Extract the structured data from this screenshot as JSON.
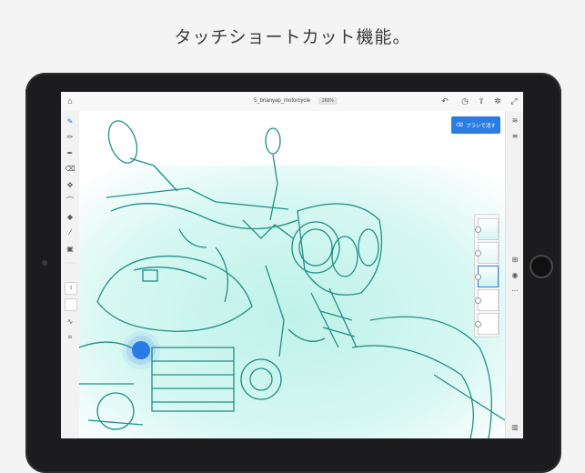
{
  "headline": "タッチショートカット機能。",
  "topbar": {
    "doc_title": "5_brianyap_motorcycle",
    "zoom": "265%",
    "home_icon": "home-icon",
    "undo_icon": "undo-icon",
    "history_icon": "history-icon",
    "share_icon": "share-icon",
    "settings_icon": "gear-icon",
    "fullscreen_icon": "expand-icon"
  },
  "left_tools": [
    {
      "name": "brush-tool",
      "glyph": "✎",
      "active": true
    },
    {
      "name": "pencil-tool",
      "glyph": "✏"
    },
    {
      "name": "ink-pen-tool",
      "glyph": "✒"
    },
    {
      "name": "eraser-tool",
      "glyph": "⌫"
    },
    {
      "name": "move-tool",
      "glyph": "✥"
    },
    {
      "name": "lasso-tool",
      "glyph": "⌒"
    },
    {
      "name": "fill-tool",
      "glyph": "◆"
    },
    {
      "name": "eyedropper-tool",
      "glyph": "⁄"
    },
    {
      "name": "image-tool",
      "glyph": "▣"
    }
  ],
  "brush_size_value": "3",
  "right_tools": [
    {
      "name": "layers-icon",
      "glyph": "≋"
    },
    {
      "name": "layer-properties-icon",
      "glyph": "≡"
    },
    {
      "name": "add-layer-icon",
      "glyph": "⊞"
    },
    {
      "name": "visibility-icon",
      "glyph": "◉"
    },
    {
      "name": "more-icon",
      "glyph": "⋯"
    },
    {
      "name": "trash-icon",
      "glyph": "▥"
    }
  ],
  "action_button": {
    "label": "ブラシで消す",
    "icon": "eraser-icon"
  },
  "colors": {
    "accent": "#2b7de4",
    "line_art": "#1f8f86",
    "wash": "#c8f3ee"
  }
}
